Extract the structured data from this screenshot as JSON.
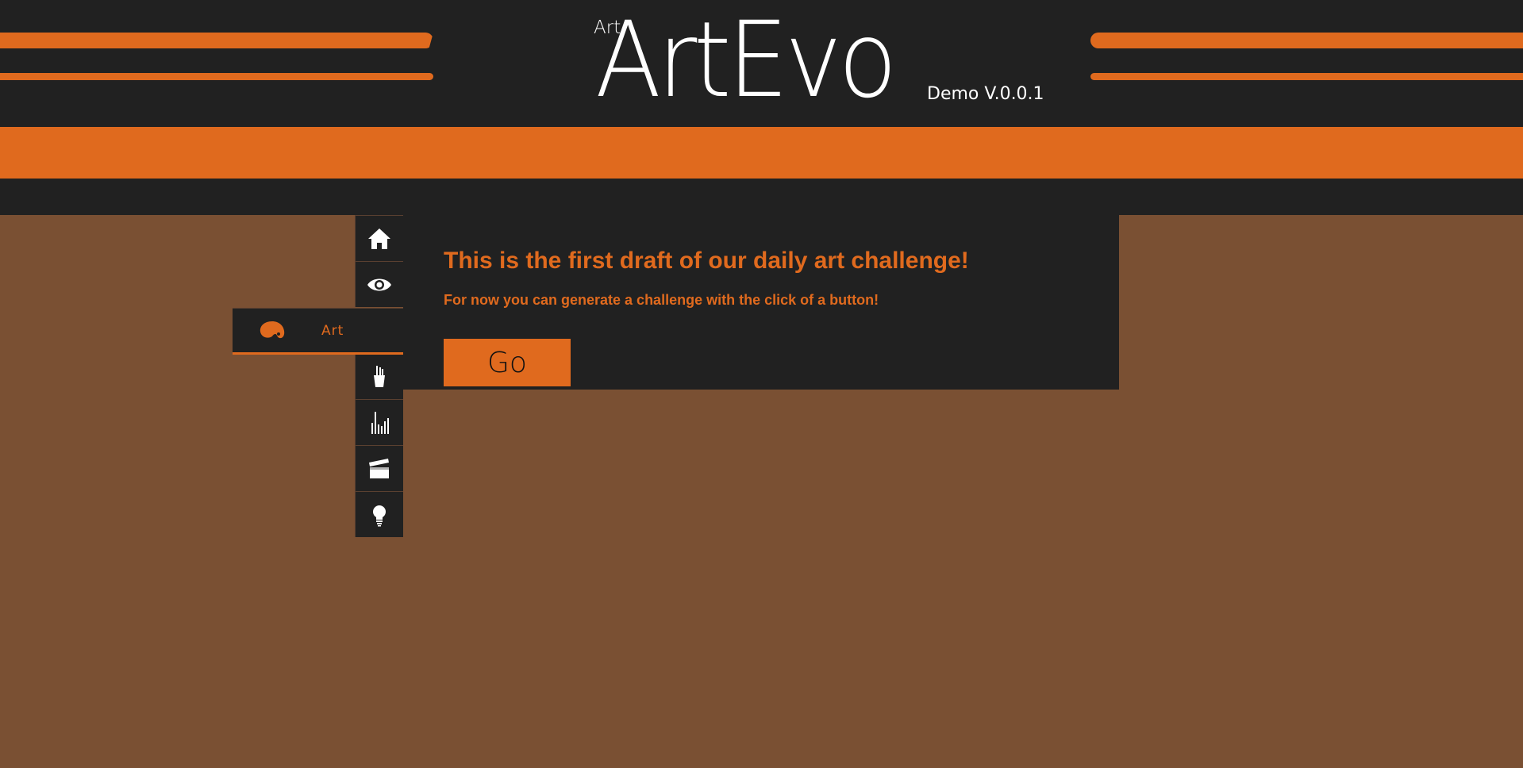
{
  "header": {
    "logo_small": "Art",
    "logo_main": "ArtEvo",
    "version": "Demo V.0.0.1"
  },
  "sidenav": {
    "items": [
      {
        "icon": "home-icon"
      },
      {
        "icon": "eye-icon"
      },
      {
        "icon": "palette-icon",
        "label": "Art",
        "active": true
      },
      {
        "icon": "brushes-icon"
      },
      {
        "icon": "bars-icon"
      },
      {
        "icon": "clapperboard-icon"
      },
      {
        "icon": "lightbulb-icon"
      }
    ]
  },
  "content": {
    "title": "This is the first draft of our daily art challenge!",
    "subtitle": "For now you can generate a challenge with the click of a button!",
    "go_label": "Go"
  },
  "colors": {
    "accent": "#e06a1e",
    "dark": "#212121",
    "background": "#7a5033"
  }
}
